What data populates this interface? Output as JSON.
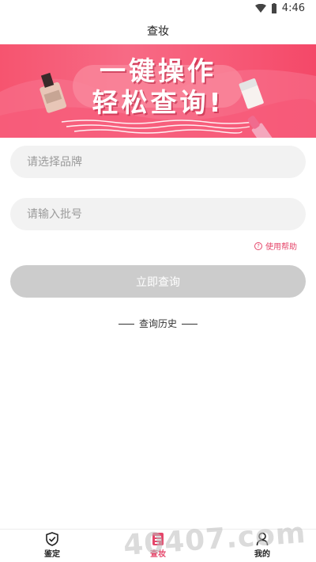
{
  "status_bar": {
    "time": "4:46"
  },
  "header": {
    "title": "查妆"
  },
  "banner": {
    "line1": "一键操作",
    "line2": "轻松查询!"
  },
  "form": {
    "brand_placeholder": "请选择品牌",
    "batch_placeholder": "请输入批号",
    "help_label": "使用帮助",
    "submit_label": "立即查询",
    "history_label": "查询历史"
  },
  "tabbar": {
    "tabs": [
      {
        "label": "鉴定",
        "icon": "shield-check-icon"
      },
      {
        "label": "查妆",
        "icon": "lipstick-icon"
      },
      {
        "label": "我的",
        "icon": "person-icon"
      }
    ],
    "active": "查妆",
    "active_color": "#e5466a"
  },
  "watermark": {
    "text": "40407.com"
  }
}
